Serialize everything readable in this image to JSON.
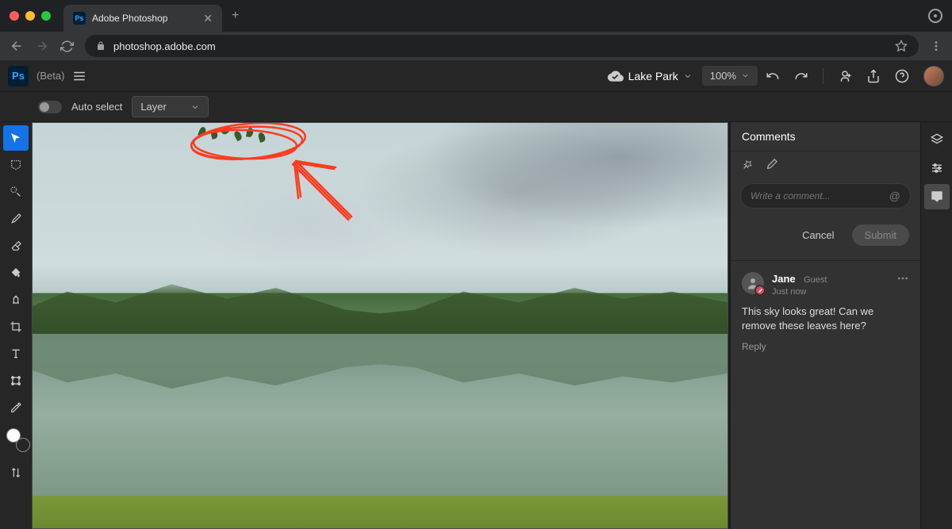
{
  "browser": {
    "tab_title": "Adobe Photoshop",
    "url": "photoshop.adobe.com"
  },
  "app": {
    "logo_text": "Ps",
    "beta_label": "(Beta)",
    "document_name": "Lake Park",
    "zoom": "100%"
  },
  "options": {
    "auto_select_label": "Auto select",
    "target_select": "Layer"
  },
  "comments": {
    "panel_title": "Comments",
    "input_placeholder": "Write a comment...",
    "cancel_label": "Cancel",
    "submit_label": "Submit",
    "items": [
      {
        "author": "Jane",
        "role": "Guest",
        "time": "Just now",
        "body": "This sky looks great! Can we remove these leaves here?",
        "reply_label": "Reply"
      }
    ]
  },
  "colors": {
    "accent": "#1473e6",
    "annotation": "#ff3b1f"
  }
}
